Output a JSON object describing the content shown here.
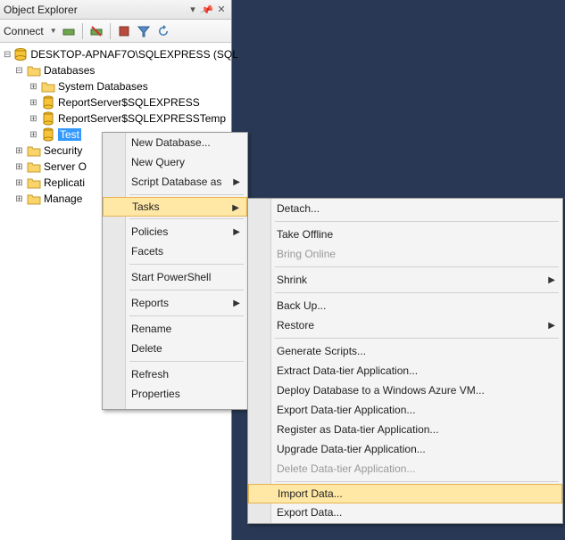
{
  "panel": {
    "title": "Object Explorer"
  },
  "toolbar": {
    "connect": "Connect"
  },
  "tree": {
    "server": "DESKTOP-APNAF7O\\SQLEXPRESS (SQL",
    "databases": "Databases",
    "sysdb": "System Databases",
    "rs1": "ReportServer$SQLEXPRESS",
    "rs2": "ReportServer$SQLEXPRESSTemp",
    "test": "Test",
    "security": "Security",
    "serverobj": "Server O",
    "replication": "Replicati",
    "management": "Manage"
  },
  "menu1": {
    "newdb": "New Database...",
    "newquery": "New Query",
    "script": "Script Database as",
    "tasks": "Tasks",
    "policies": "Policies",
    "facets": "Facets",
    "startps": "Start PowerShell",
    "reports": "Reports",
    "rename": "Rename",
    "delete": "Delete",
    "refresh": "Refresh",
    "properties": "Properties"
  },
  "menu2": {
    "detach": "Detach...",
    "offline": "Take Offline",
    "online": "Bring Online",
    "shrink": "Shrink",
    "backup": "Back Up...",
    "restore": "Restore",
    "genscripts": "Generate Scripts...",
    "extract": "Extract Data-tier Application...",
    "deployazure": "Deploy Database to a Windows Azure VM...",
    "exportdta": "Export Data-tier Application...",
    "registerdta": "Register as Data-tier Application...",
    "upgradedta": "Upgrade Data-tier Application...",
    "deletedta": "Delete Data-tier Application...",
    "importdata": "Import Data...",
    "exportdata": "Export Data..."
  }
}
